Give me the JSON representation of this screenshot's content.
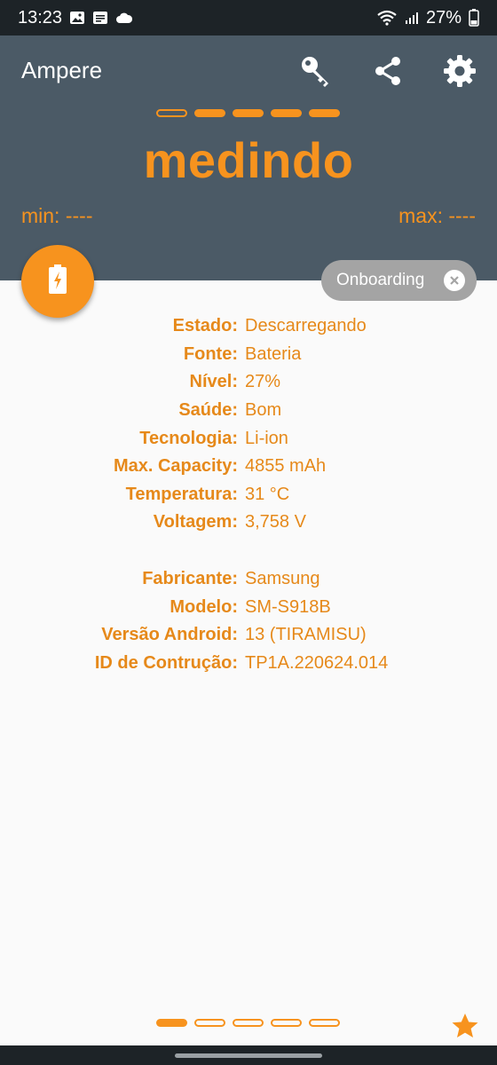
{
  "status_bar": {
    "time": "13:23",
    "battery_percent": "27%",
    "left_icons": [
      "image-icon",
      "message-icon",
      "cloud-icon"
    ],
    "right_icons": [
      "wifi-icon",
      "signal-icon",
      "battery-icon"
    ]
  },
  "app": {
    "title": "Ampere",
    "toolbar_icons": [
      "key-icon",
      "share-icon",
      "gear-icon"
    ]
  },
  "header": {
    "status_text": "medindo",
    "min_label": "min: ----",
    "max_label": "max: ----",
    "top_dashes": [
      "outline",
      "filled",
      "filled",
      "filled",
      "filled"
    ]
  },
  "chip": {
    "label": "Onboarding"
  },
  "battery_info": [
    {
      "key": "Estado:",
      "value": "Descarregando"
    },
    {
      "key": "Fonte:",
      "value": "Bateria"
    },
    {
      "key": "Nível:",
      "value": "27%"
    },
    {
      "key": "Saúde:",
      "value": "Bom"
    },
    {
      "key": "Tecnologia:",
      "value": "Li-ion"
    },
    {
      "key": "Max. Capacity:",
      "value": "4855 mAh"
    },
    {
      "key": "Temperatura:",
      "value": "31 °C"
    },
    {
      "key": "Voltagem:",
      "value": "3,758 V"
    }
  ],
  "device_info": [
    {
      "key": "Fabricante:",
      "value": "Samsung"
    },
    {
      "key": "Modelo:",
      "value": "SM-S918B"
    },
    {
      "key": "Versão Android:",
      "value": "13 (TIRAMISU)"
    },
    {
      "key": "ID de Contrução:",
      "value": "TP1A.220624.014"
    }
  ],
  "pager": {
    "pages": 5,
    "current_page": 1
  },
  "colors": {
    "accent": "#f7931e",
    "header_bg": "#4b5a66",
    "chip_bg": "#a4a4a4",
    "status_bar_bg": "#1d2327"
  }
}
